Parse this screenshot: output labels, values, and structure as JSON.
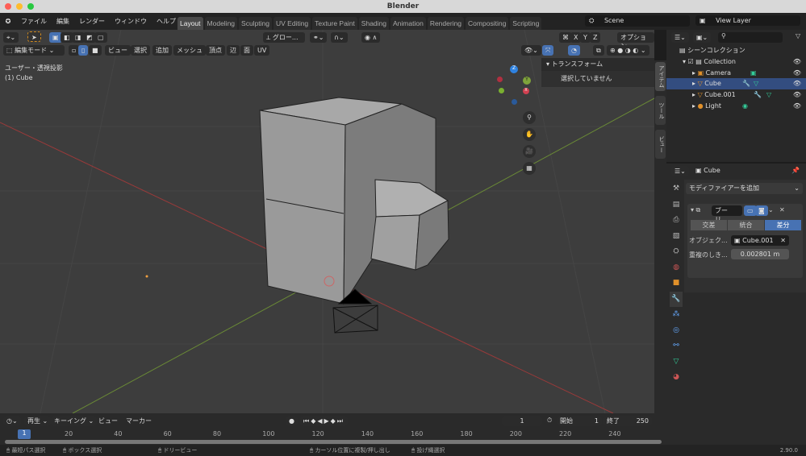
{
  "window": {
    "title": "Blender"
  },
  "menu": [
    "ファイル",
    "編集",
    "レンダー",
    "ウィンドウ",
    "ヘルプ"
  ],
  "workspaces": [
    "Layout",
    "Modeling",
    "Sculpting",
    "UV Editing",
    "Texture Paint",
    "Shading",
    "Animation",
    "Rendering",
    "Compositing",
    "Scripting"
  ],
  "active_workspace": "Layout",
  "scene": "Scene",
  "view_layer": "View Layer",
  "viewport": {
    "transform_orientation": "グロー...",
    "options": "オプション",
    "mode": "編集モード",
    "header_menus": [
      "ビュー",
      "選択",
      "追加",
      "メッシュ",
      "頂点",
      "辺",
      "面",
      "UV"
    ],
    "view_label": "ユーザー・透視投影",
    "object_label": "(1) Cube",
    "axes": [
      "X",
      "Y",
      "Z"
    ],
    "gizmo": {
      "x": "X",
      "y": "Y",
      "z": "Z"
    },
    "npanel": {
      "title": "トランスフォーム",
      "empty": "選択していません"
    },
    "sidebar_tabs": [
      "アイテム",
      "ツール",
      "ビュー"
    ]
  },
  "outliner": {
    "search_placeholder": "",
    "items": [
      {
        "label": "シーンコレクション"
      },
      {
        "label": "Collection"
      },
      {
        "label": "Camera"
      },
      {
        "label": "Cube",
        "selected": true
      },
      {
        "label": "Cube.001"
      },
      {
        "label": "Light"
      }
    ]
  },
  "properties": {
    "object": "Cube",
    "add_modifier": "モディファイアーを追加",
    "modifier_name": "ブーリ...",
    "operations": [
      "交差",
      "統合",
      "差分"
    ],
    "active_operation": "差分",
    "object_label": "オブジェク...",
    "object_value": "Cube.001",
    "threshold_label": "重複のしき...",
    "threshold_value": "0.002801 m"
  },
  "timeline": {
    "menus": [
      "再生",
      "キーイング",
      "ビュー",
      "マーカー"
    ],
    "current_frame": "1",
    "start_label": "開始",
    "start": "1",
    "end_label": "終了",
    "end": "250",
    "ticks": [
      "20",
      "40",
      "60",
      "80",
      "100",
      "120",
      "140",
      "160",
      "180",
      "200",
      "220",
      "240"
    ],
    "playhead": "1"
  },
  "status": {
    "items": [
      "最短パス選択",
      "ボックス選択",
      "ドリービュー",
      "カーソル位置に複製/押し出し",
      "投げ縄選択"
    ],
    "version": "2.90.0"
  },
  "colors": {
    "accent": "#4772b3",
    "selected_row": "#334d80",
    "x_axis": "#c0392b",
    "y_axis": "#7fa33b"
  }
}
